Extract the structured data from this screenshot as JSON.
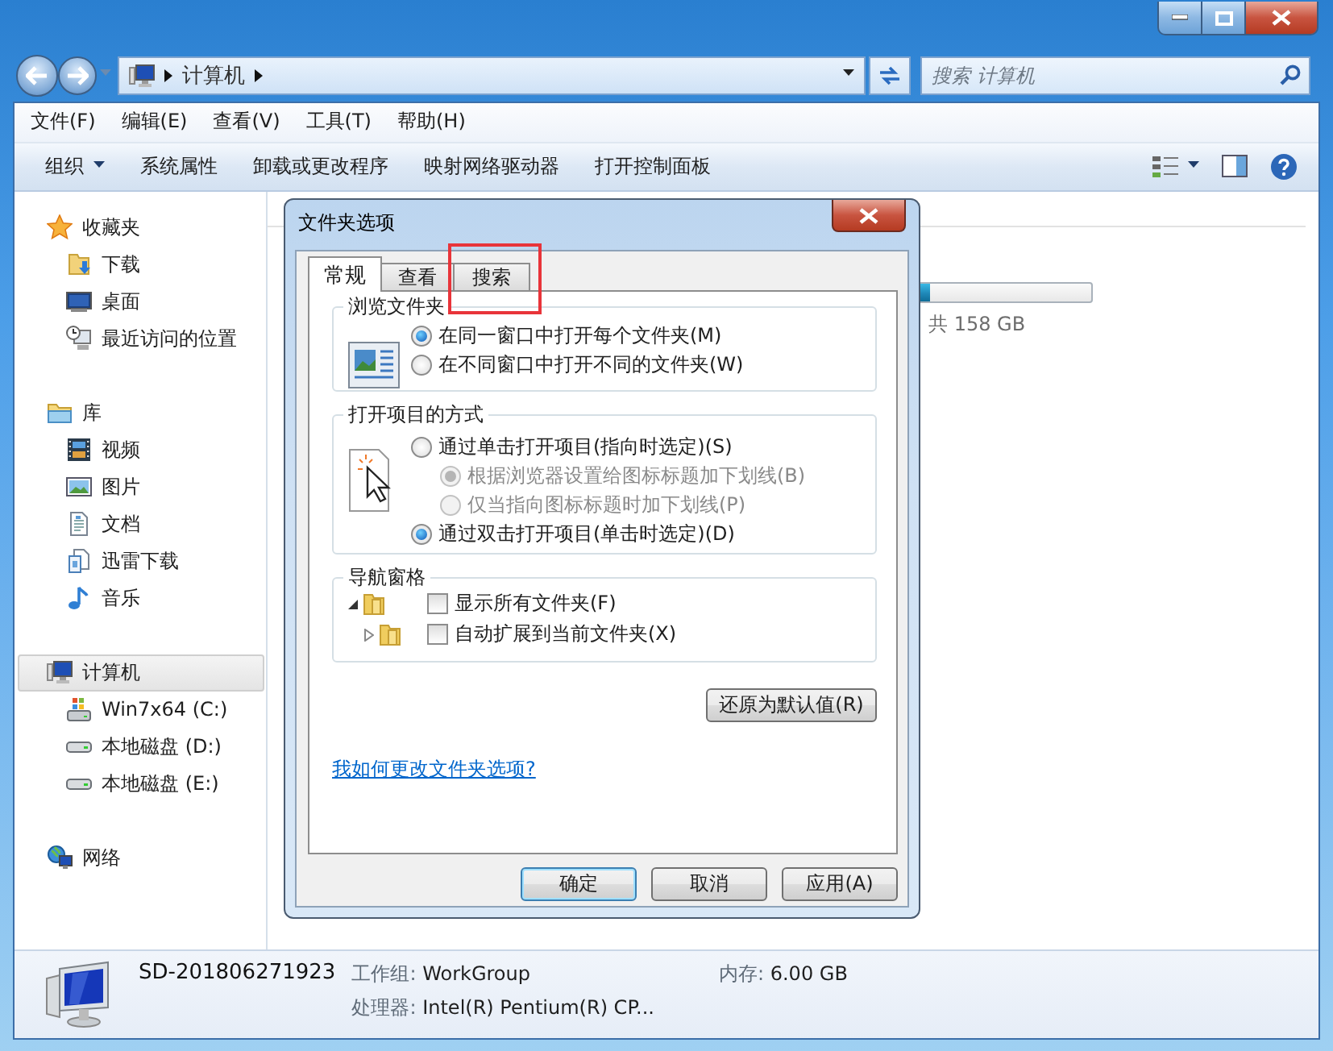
{
  "window": {
    "address": [
      "计算机"
    ],
    "search": {
      "placeholder": "搜索 计算机"
    }
  },
  "menu": [
    "文件(F)",
    "编辑(E)",
    "查看(V)",
    "工具(T)",
    "帮助(H)"
  ],
  "toolbar": [
    {
      "label": "组织",
      "has_menu": true
    },
    {
      "label": "系统属性",
      "has_menu": false
    },
    {
      "label": "卸载或更改程序",
      "has_menu": false
    },
    {
      "label": "映射网络驱动器",
      "has_menu": false
    },
    {
      "label": "打开控制面板",
      "has_menu": false
    }
  ],
  "sidebar": [
    {
      "label": "收藏夹",
      "kind": "favorites",
      "selected": false,
      "children": [
        {
          "label": "下载",
          "kind": "downloads",
          "selected": false
        },
        {
          "label": "桌面",
          "kind": "desktop",
          "selected": false
        },
        {
          "label": "最近访问的位置",
          "kind": "recent",
          "selected": false
        }
      ]
    },
    {
      "label": "库",
      "kind": "libraries",
      "selected": false,
      "children": [
        {
          "label": "视频",
          "kind": "videos",
          "selected": false
        },
        {
          "label": "图片",
          "kind": "pictures",
          "selected": false
        },
        {
          "label": "文档",
          "kind": "documents",
          "selected": false
        },
        {
          "label": "迅雷下载",
          "kind": "documents2",
          "selected": false
        },
        {
          "label": "音乐",
          "kind": "music",
          "selected": false
        }
      ]
    },
    {
      "label": "计算机",
      "kind": "computer",
      "selected": true,
      "children": [
        {
          "label": "Win7x64 (C:)",
          "kind": "system-drive",
          "selected": false
        },
        {
          "label": "本地磁盘 (D:)",
          "kind": "drive",
          "selected": false
        },
        {
          "label": "本地磁盘 (E:)",
          "kind": "drive",
          "selected": false
        }
      ]
    },
    {
      "label": "网络",
      "kind": "network",
      "selected": false
    }
  ],
  "content": {
    "drive_usage": {
      "level": 0.09,
      "size_text": "共 158 GB"
    }
  },
  "status_bar": {
    "computer_name": "SD-201806271923",
    "fields": [
      {
        "label": "工作组:",
        "value": "WorkGroup"
      },
      {
        "label": "内存:",
        "value": "6.00 GB"
      },
      {
        "label": "处理器:",
        "value": "Intel(R) Pentium(R) CP..."
      }
    ]
  },
  "dialog": {
    "title": "文件夹选项",
    "tabs": [
      {
        "label": "常规",
        "selected": true,
        "highlighted": false
      },
      {
        "label": "查看",
        "selected": false,
        "highlighted": false
      },
      {
        "label": "搜索",
        "selected": false,
        "highlighted": true
      }
    ],
    "groups": [
      {
        "title": "浏览文件夹",
        "kind": "radio",
        "options": [
          {
            "label": "在同一窗口中打开每个文件夹(M)",
            "selected": true,
            "disabled": false
          },
          {
            "label": "在不同窗口中打开不同的文件夹(W)",
            "selected": false,
            "disabled": false
          }
        ]
      },
      {
        "title": "打开项目的方式",
        "kind": "radio",
        "options": [
          {
            "label": "通过单击打开项目(指向时选定)(S)",
            "selected": false,
            "disabled": false,
            "children": [
              {
                "label": "根据浏览器设置给图标标题加下划线(B)",
                "selected": true,
                "disabled": true
              },
              {
                "label": "仅当指向图标标题时加下划线(P)",
                "selected": false,
                "disabled": true
              }
            ]
          },
          {
            "label": "通过双击打开项目(单击时选定)(D)",
            "selected": true,
            "disabled": false
          }
        ]
      },
      {
        "title": "导航窗格",
        "kind": "checkbox",
        "options": [
          {
            "label": "显示所有文件夹(F)",
            "checked": false
          },
          {
            "label": "自动扩展到当前文件夹(X)",
            "checked": false
          }
        ]
      }
    ],
    "restore_button": "还原为默认值(R)",
    "help_link": "我如何更改文件夹选项?",
    "buttons": [
      {
        "label": "确定",
        "default": true
      },
      {
        "label": "取消",
        "default": false
      },
      {
        "label": "应用(A)",
        "default": false
      }
    ]
  }
}
